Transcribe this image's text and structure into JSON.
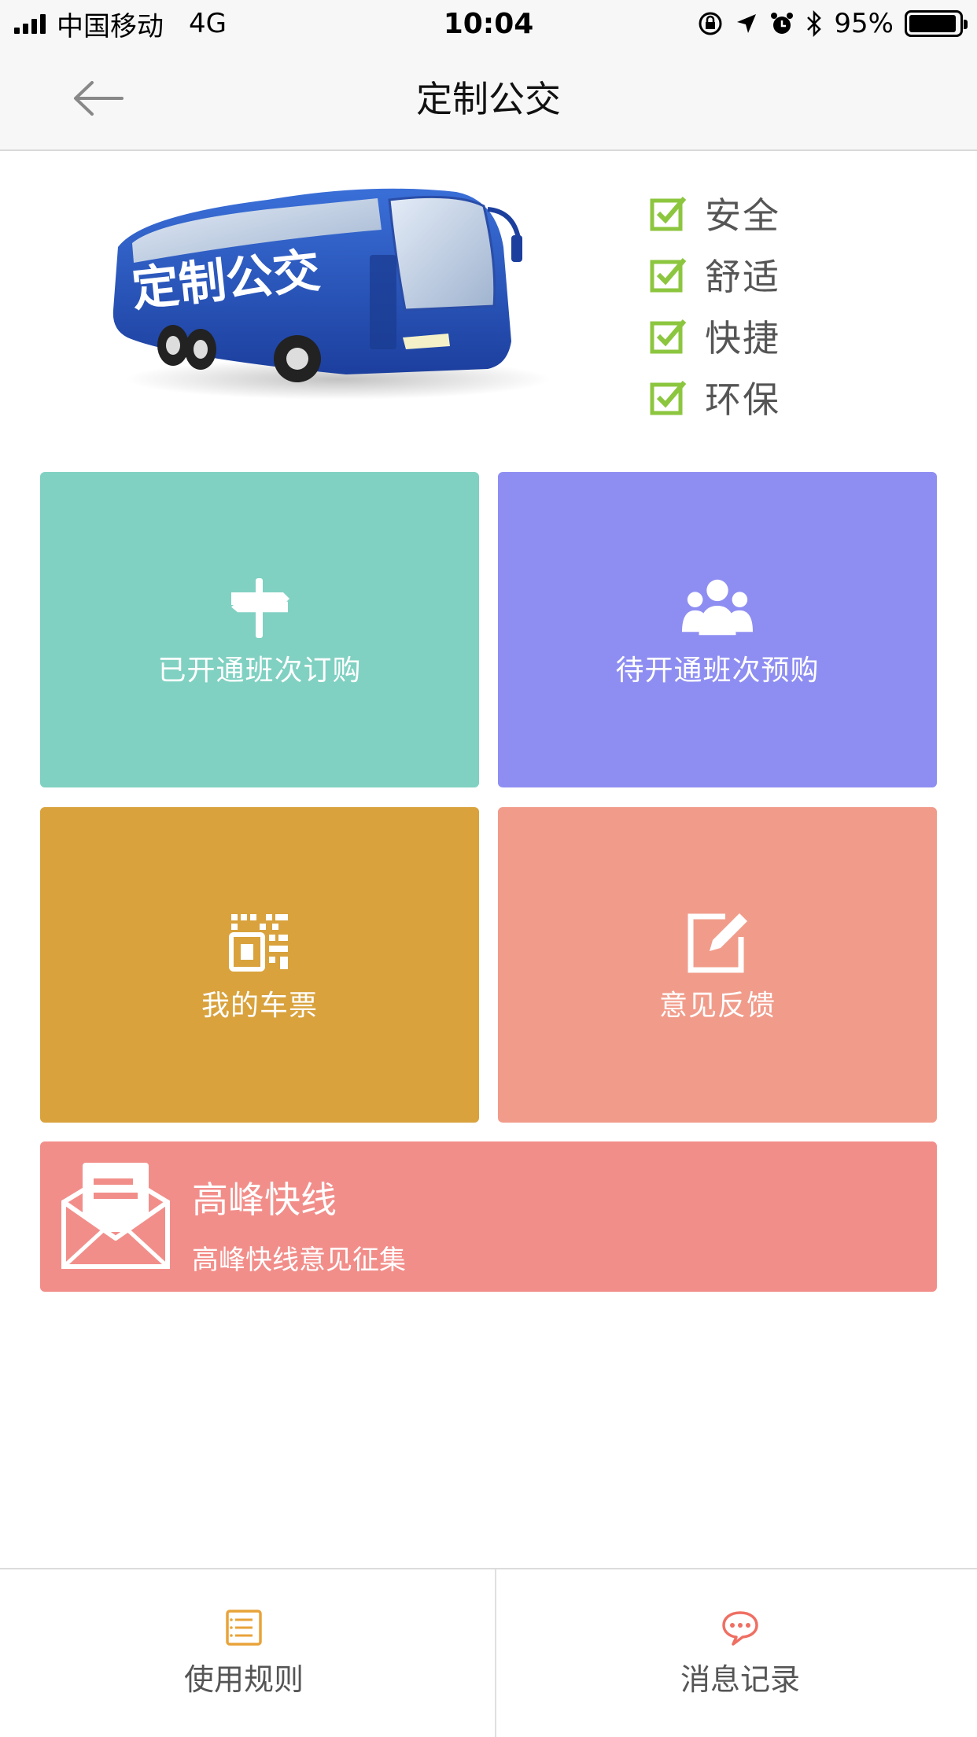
{
  "status_bar": {
    "carrier": "中国移动",
    "network": "4G",
    "time": "10:04",
    "battery": "95%",
    "battery_level": 0.95
  },
  "nav": {
    "title": "定制公交",
    "back_icon": "back-arrow-icon"
  },
  "banner": {
    "bus_text": "定制公交",
    "features": [
      "安全",
      "舒适",
      "快捷",
      "环保"
    ],
    "check_color": "#8cc63f"
  },
  "tiles": [
    {
      "label": "已开通班次订购",
      "icon": "signpost-icon",
      "color": "#80d1c2"
    },
    {
      "label": "待开通班次预购",
      "icon": "group-icon",
      "color": "#8e8ef2"
    },
    {
      "label": "我的车票",
      "icon": "qr-code-icon",
      "color": "#d9a23d"
    },
    {
      "label": "意见反馈",
      "icon": "edit-icon",
      "color": "#f19c8b"
    }
  ],
  "wide_card": {
    "title": "高峰快线",
    "subtitle": "高峰快线意见征集",
    "icon": "envelope-icon",
    "color": "#f28e8a"
  },
  "tab_bar": {
    "left": {
      "label": "使用规则",
      "icon": "document-icon",
      "color": "#e8a33a"
    },
    "right": {
      "label": "消息记录",
      "icon": "chat-bubble-icon",
      "color": "#ef6f63"
    }
  }
}
